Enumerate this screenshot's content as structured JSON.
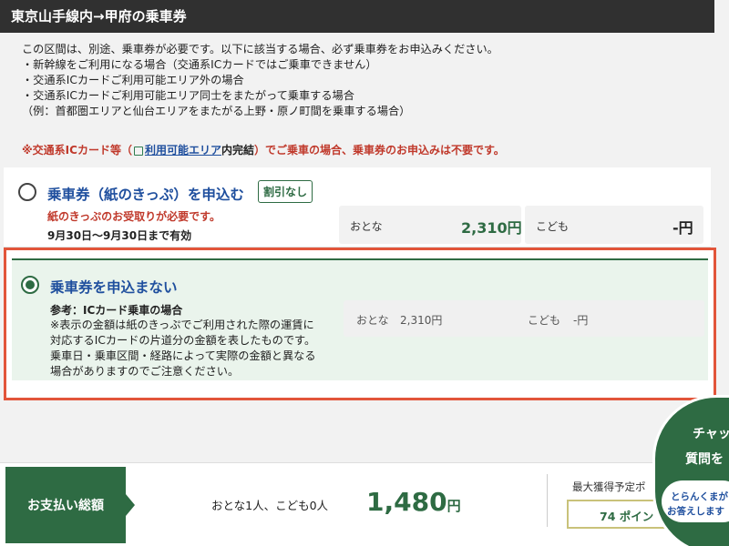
{
  "header": {
    "title": "東京山手線内→甲府の乗車券"
  },
  "notice": {
    "lines": [
      "この区間は、別途、乗車券が必要です。以下に該当する場合、必ず乗車券をお申込みください。",
      "・新幹線をご利用になる場合（交通系ICカードではご乗車できません）",
      "・交通系ICカードご利用可能エリア外の場合",
      "・交通系ICカードご利用可能エリア同士をまたがって乗車する場合",
      "（例：首都圏エリアと仙台エリアをまたがる上野・原ノ町間を乗車する場合）"
    ]
  },
  "ic_note": {
    "prefix": "※交通系ICカード等（",
    "link": "利用可能エリア",
    "mid": "内完結",
    "suffix": "）でご乗車の場合、乗車券のお申込みは不要です。"
  },
  "option_paper": {
    "title": "乗車券（紙のきっぷ）を申込む",
    "tag": "割引なし",
    "subtitle": "紙のきっぷのお受取りが必要です。",
    "validity": "9月30日〜9月30日まで有効",
    "adult_label": "おとな",
    "adult_price": "2,310円",
    "child_label": "こども",
    "child_price": "-円",
    "selected": false
  },
  "option_none": {
    "title": "乗車券を申込まない",
    "ref_title": "参考：ICカード乗車の場合",
    "ref_body": "※表示の金額は紙のきっぷでご利用された際の運賃に対応するICカードの片道分の金額を表したものです。乗車日・乗車区間・経路によって実際の金額と異なる場合がありますのでご注意ください。",
    "adult_label": "おとな",
    "adult_price": "2,310円",
    "child_label": "こども",
    "child_price": "-円",
    "selected": true
  },
  "footer": {
    "pay_label": "お支払い総額",
    "passengers": "おとな1人、こども0人",
    "total": "1,480",
    "total_unit": "円",
    "points_label": "最大獲得予定ポ",
    "points_value": "74 ポイン"
  },
  "chat": {
    "line1": "チャッ",
    "line2": "質問を",
    "inner1": "とらんくまが",
    "inner2": "お答えします"
  },
  "colors": {
    "accent_green": "#2e6b43",
    "link_blue": "#1f4f9e",
    "alert_red": "#c0392b",
    "highlight": "#e2553a"
  }
}
